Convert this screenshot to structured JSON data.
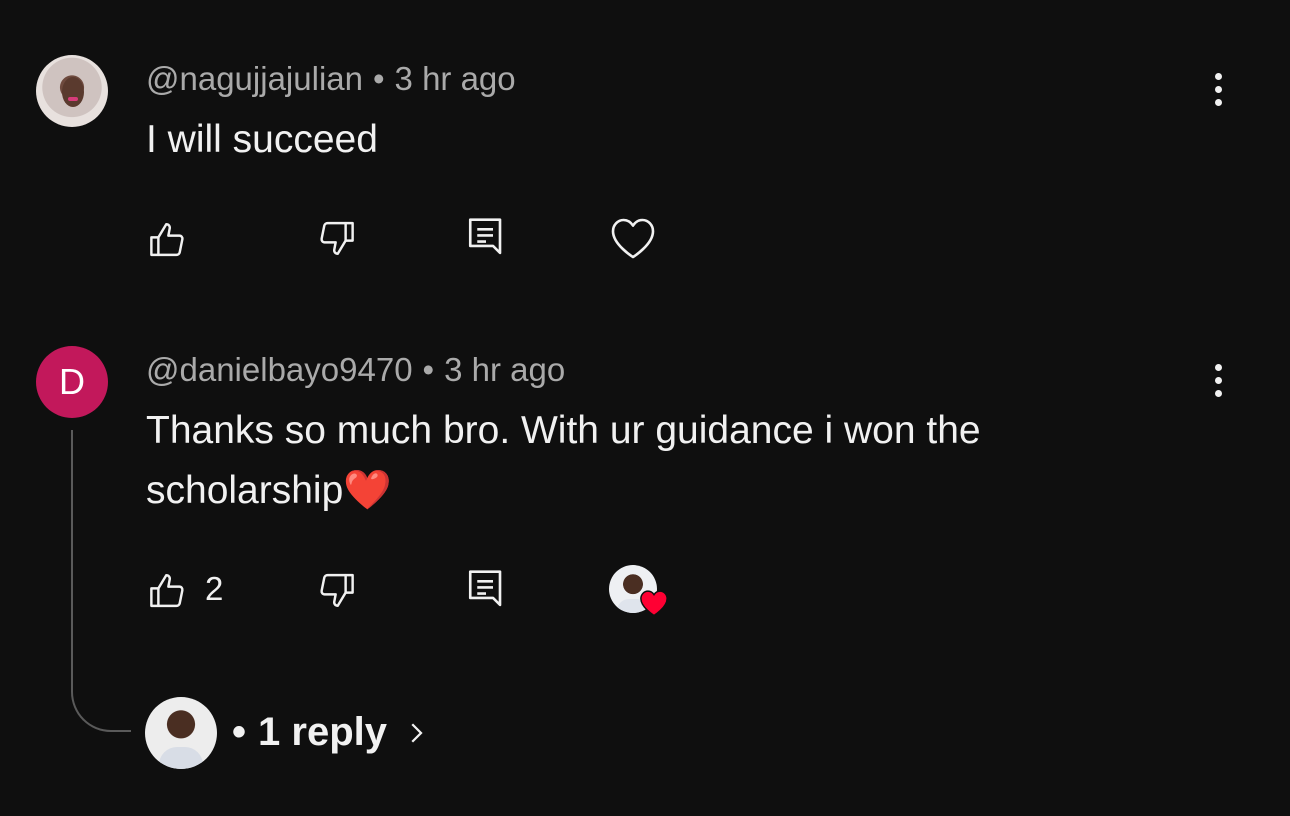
{
  "comments": [
    {
      "username": "@nagujjajulian",
      "separator": "•",
      "time": "3 hr ago",
      "text": "I will succeed",
      "like_count": ""
    },
    {
      "avatar_letter": "D",
      "username": "@danielbayo9470",
      "separator": "•",
      "time": "3 hr ago",
      "text_line1": "Thanks so much bro. With ur guidance i won the",
      "text_line2": "scholarship❤️",
      "like_count": "2",
      "replies": {
        "separator": "•",
        "label": "1 reply",
        "chevron": "›"
      }
    }
  ],
  "icons": {
    "like": "thumbs-up-icon",
    "dislike": "thumbs-down-icon",
    "reply": "reply-icon",
    "heart": "heart-icon",
    "more": "more-vertical-icon"
  },
  "colors": {
    "background": "#0f0f0f",
    "text": "#f1f1f1",
    "meta": "#aaaaaa",
    "avatar_d": "#c2185b",
    "heart_red": "#ff0033"
  }
}
